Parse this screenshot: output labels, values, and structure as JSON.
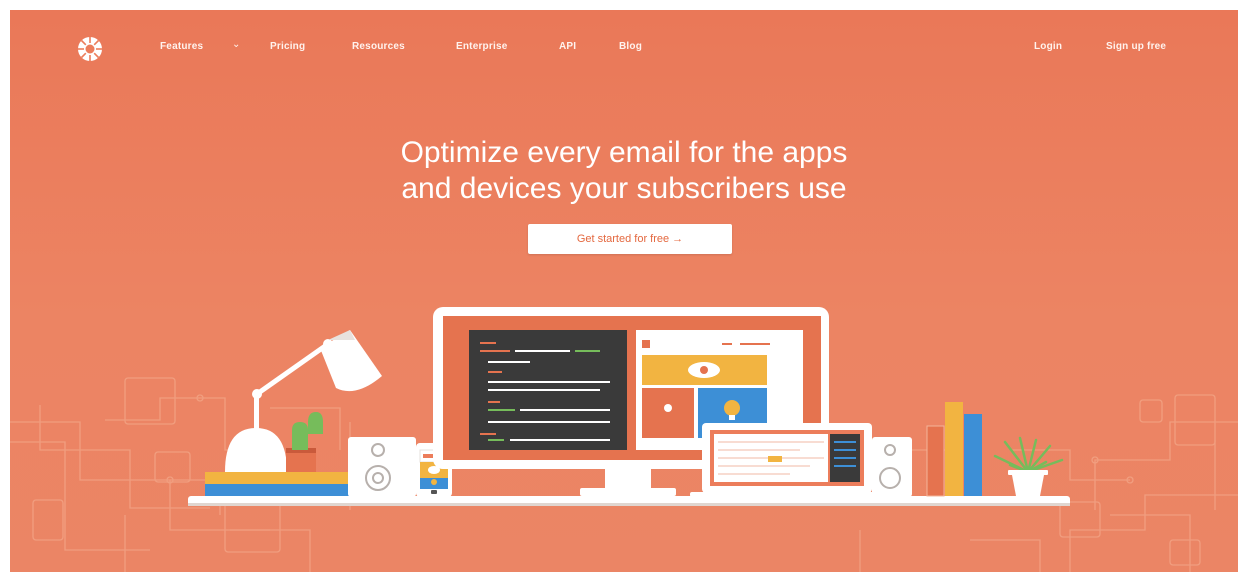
{
  "nav": {
    "links": [
      {
        "label": "Features"
      },
      {
        "label": "Pricing"
      },
      {
        "label": "Resources"
      },
      {
        "label": "Enterprise"
      },
      {
        "label": "API"
      },
      {
        "label": "Blog"
      }
    ],
    "features_icon": "chevron-down-icon",
    "login": "Login",
    "signup": "Sign up free"
  },
  "hero": {
    "headline_line1": "Optimize every email for the apps",
    "headline_line2": "and devices your subscribers use",
    "cta_label": "Get started for free →"
  },
  "colors": {
    "background": "#ec7d5b",
    "cta_text": "#e4683f",
    "accent_yellow": "#f2b441",
    "accent_blue": "#3d8fd6"
  }
}
